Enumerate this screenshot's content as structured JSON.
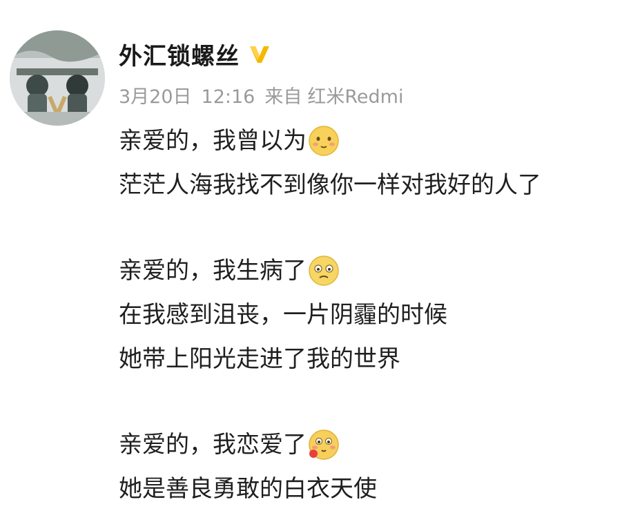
{
  "author": {
    "name": "外汇锁螺丝",
    "verified_icon": "verified-v-icon",
    "verified_color": "#f5b800"
  },
  "meta": {
    "date": "3月20日",
    "time": "12:16",
    "source_prefix": "来自",
    "source_app": "红米Redmi"
  },
  "paragraphs": [
    {
      "lines": [
        {
          "text": "亲爱的，我曾以为",
          "emoji": "smile-emoji-icon"
        },
        {
          "text": "茫茫人海我找不到像你一样对我好的人了"
        }
      ]
    },
    {
      "lines": [
        {
          "text": "亲爱的，我生病了",
          "emoji": "sick-emoji-icon"
        },
        {
          "text": "在我感到沮丧，一片阴霾的时候"
        },
        {
          "text": "她带上阳光走进了我的世界"
        }
      ]
    },
    {
      "lines": [
        {
          "text": "亲爱的，我恋爱了",
          "emoji": "love-emoji-icon"
        },
        {
          "text": "她是善良勇敢的白衣天使"
        }
      ]
    }
  ]
}
